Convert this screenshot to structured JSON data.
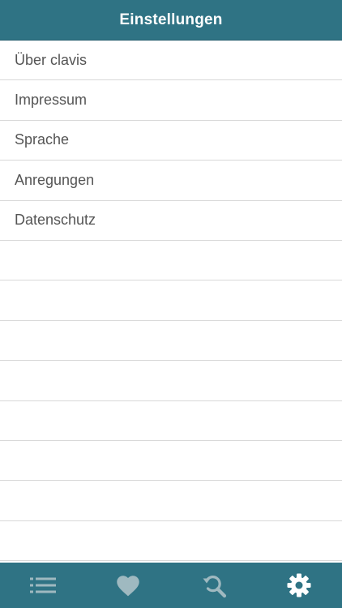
{
  "navbar": {
    "title": "Einstellungen"
  },
  "settings": {
    "items": [
      {
        "label": "Über clavis"
      },
      {
        "label": "Impressum"
      },
      {
        "label": "Sprache"
      },
      {
        "label": "Anregungen"
      },
      {
        "label": "Datenschutz"
      }
    ]
  },
  "tabbar": {
    "tabs": [
      {
        "icon": "list-icon",
        "active": false
      },
      {
        "icon": "heart-icon",
        "active": false
      },
      {
        "icon": "search-refresh-icon",
        "active": false
      },
      {
        "icon": "gear-icon",
        "active": true
      }
    ],
    "active_color": "#ffffff",
    "inactive_color": "#9fb9c0"
  },
  "colors": {
    "brand": "#2f7384",
    "separator": "#d8d8d8",
    "text": "#555555"
  }
}
